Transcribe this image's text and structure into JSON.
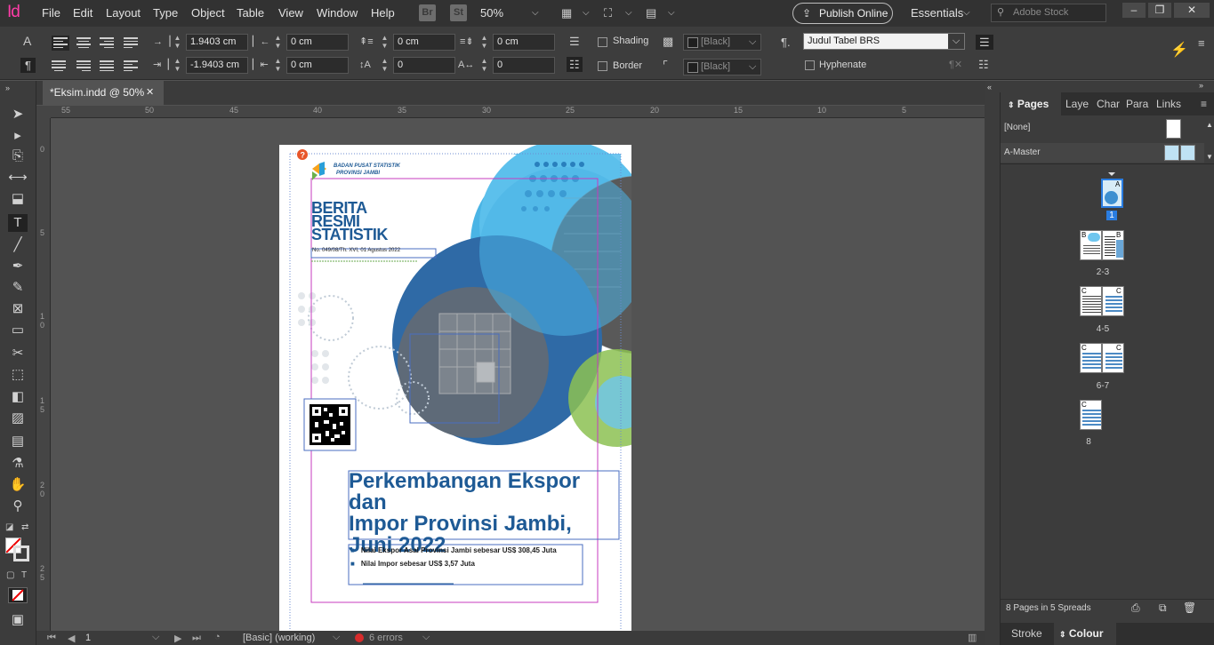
{
  "app": {
    "logo": "Id"
  },
  "menu": [
    "File",
    "Edit",
    "Layout",
    "Type",
    "Object",
    "Table",
    "View",
    "Window",
    "Help"
  ],
  "menubar": {
    "bridge": "Br",
    "stock": "St",
    "zoom": "50%",
    "publish_label": "Publish Online",
    "workspace": "Essentials",
    "search_placeholder": "Adobe Stock"
  },
  "control": {
    "left_indent": "1.9403 cm",
    "first_indent": "-1.9403 cm",
    "right_indent": "0 cm",
    "last_indent": "0 cm",
    "space_before": "0 cm",
    "space_after": "0 cm",
    "drop_lines": "0",
    "drop_chars": "0",
    "shading_label": "Shading",
    "border_label": "Border",
    "shading_swatch": "[Black]",
    "border_swatch": "[Black]",
    "para_style": "Judul Tabel BRS",
    "hyphenate_label": "Hyphenate"
  },
  "doc_tab": {
    "title": "*Eksim.indd @ 50%"
  },
  "ruler_h": [
    "55",
    "50",
    "45",
    "40",
    "35",
    "30",
    "25",
    "20",
    "15",
    "10",
    "5"
  ],
  "ruler_v": [
    "0",
    "5",
    "1 0",
    "1 5",
    "2 0",
    "2 5"
  ],
  "status": {
    "page": "1",
    "preflight_profile": "[Basic] (working)",
    "errors": "6 errors"
  },
  "panel": {
    "tabs": [
      "Pages",
      "Laye",
      "Char",
      "Para",
      "Links"
    ],
    "none_label": "[None]",
    "master_label": "A-Master",
    "spreads": [
      {
        "label": "1",
        "masters": [
          "A"
        ]
      },
      {
        "label": "2-3",
        "masters": [
          "B",
          "B"
        ]
      },
      {
        "label": "4-5",
        "masters": [
          "C",
          "C"
        ]
      },
      {
        "label": "6-7",
        "masters": [
          "C",
          "C"
        ]
      },
      {
        "label": "8",
        "masters": [
          "C"
        ]
      }
    ],
    "footer": "8 Pages in 5 Spreads",
    "bottom_tabs": [
      "Stroke",
      "Colour"
    ]
  },
  "document": {
    "bps_line1": "BADAN PUSAT STATISTIK",
    "bps_line2": "PROVINSI JAMBI",
    "brs": [
      "BERITA",
      "RESMI",
      "STATISTIK"
    ],
    "number": "No. 049/08/Th. XVI, 01 Agustus 2022",
    "title_lines": [
      "Perkembangan Ekspor dan",
      "Impor Provinsi Jambi,",
      "Juni 2022"
    ],
    "bullets": [
      "Nilai Ekspor Asal Provinsi Jambi sebesar US$ 308,45 Juta",
      "Nilai Impor sebesar US$ 3,57 Juta"
    ]
  },
  "colors": {
    "brand_blue": "#1e5a95",
    "accent_magenta": "#ff3ca8"
  }
}
